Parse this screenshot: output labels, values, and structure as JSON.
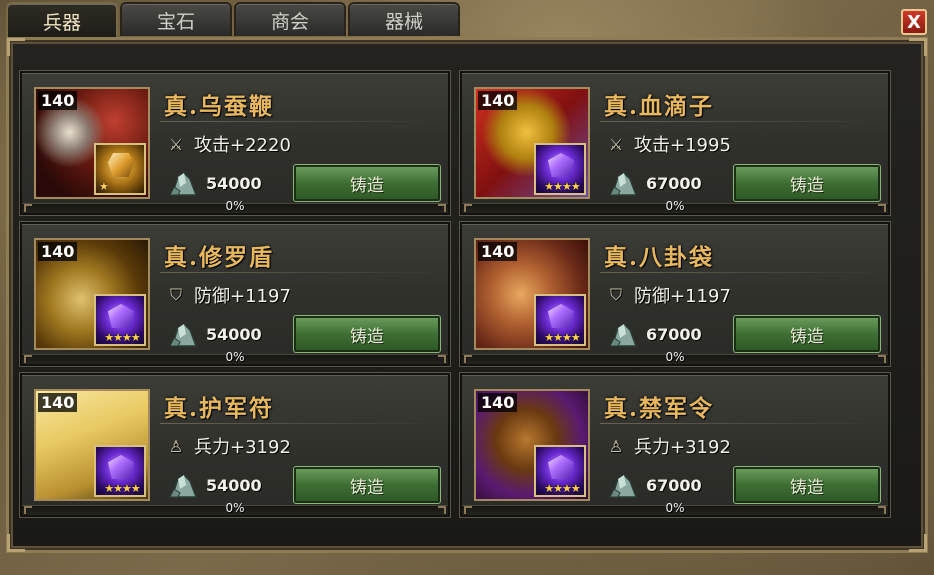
{
  "tabs": [
    {
      "label": "兵器",
      "active": true
    },
    {
      "label": "宝石",
      "active": false
    },
    {
      "label": "商会",
      "active": false
    },
    {
      "label": "器械",
      "active": false
    }
  ],
  "close_label": "X",
  "items": [
    {
      "name": "真.乌蚕鞭",
      "level": "140",
      "stat_icon": "sword-icon",
      "stat": "攻击+2220",
      "cost": "54000",
      "button": "铸造",
      "progress": "0%",
      "progress_value": 0,
      "gem": "gold",
      "stars": "★"
    },
    {
      "name": "真.血滴子",
      "level": "140",
      "stat_icon": "sword-icon",
      "stat": "攻击+1995",
      "cost": "67000",
      "button": "铸造",
      "progress": "0%",
      "progress_value": 0,
      "gem": "purple",
      "stars": "★★★★"
    },
    {
      "name": "真.修罗盾",
      "level": "140",
      "stat_icon": "shield-icon",
      "stat": "防御+1197",
      "cost": "54000",
      "button": "铸造",
      "progress": "0%",
      "progress_value": 0,
      "gem": "purple",
      "stars": "★★★★"
    },
    {
      "name": "真.八卦袋",
      "level": "140",
      "stat_icon": "shield-icon",
      "stat": "防御+1197",
      "cost": "67000",
      "button": "铸造",
      "progress": "0%",
      "progress_value": 0,
      "gem": "purple",
      "stars": "★★★★"
    },
    {
      "name": "真.护军符",
      "level": "140",
      "stat_icon": "soldier-icon",
      "stat": "兵力+3192",
      "cost": "54000",
      "button": "铸造",
      "progress": "0%",
      "progress_value": 0,
      "gem": "purple",
      "stars": "★★★★"
    },
    {
      "name": "真.禁军令",
      "level": "140",
      "stat_icon": "soldier-icon",
      "stat": "兵力+3192",
      "cost": "67000",
      "button": "铸造",
      "progress": "0%",
      "progress_value": 0,
      "gem": "purple",
      "stars": "★★★★"
    }
  ],
  "colors": {
    "name_text": "#e8b860",
    "button_green": "#3f6e34",
    "panel_border": "#8f7c55",
    "close_red": "#d03a2a"
  }
}
